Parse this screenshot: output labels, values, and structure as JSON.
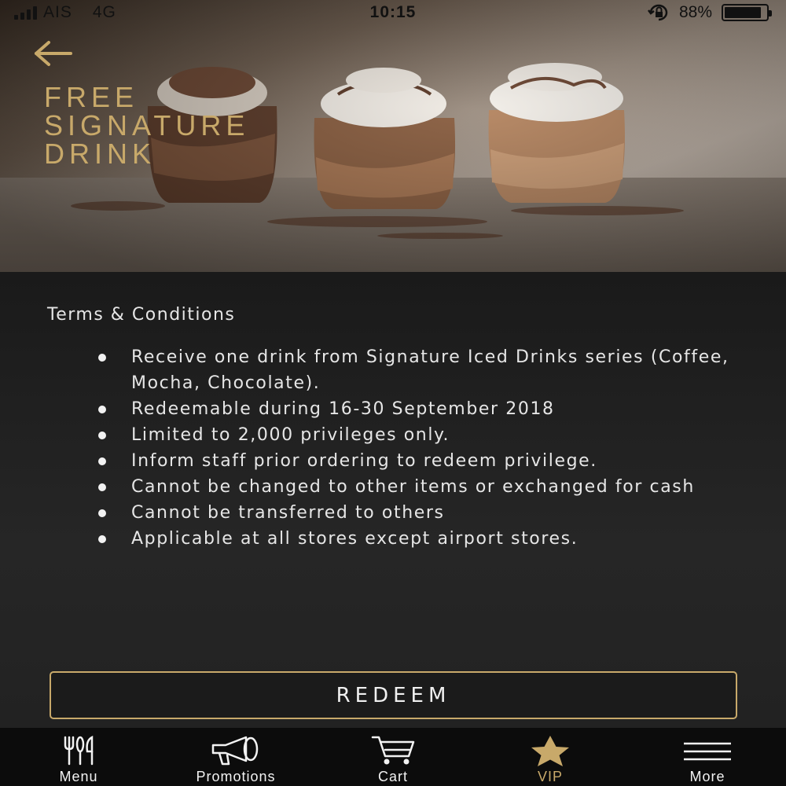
{
  "status_bar": {
    "carrier": "AIS",
    "network": "4G",
    "time": "10:15",
    "battery_percent": "88%",
    "battery_level": 0.88,
    "icons": [
      "signal-icon",
      "rotation-lock-icon",
      "battery-icon"
    ]
  },
  "hero": {
    "title_lines": [
      "FREE",
      "SIGNATURE",
      "DRINK"
    ],
    "back_icon": "arrow-left-icon"
  },
  "terms": {
    "heading": "Terms & Conditions",
    "items": [
      "Receive one drink from Signature Iced Drinks series (Coffee, Mocha, Chocolate).",
      "Redeemable during 16-30 September 2018",
      "Limited to 2,000 privileges only.",
      "Inform staff prior ordering to redeem privilege.",
      "Cannot be changed to other items or exchanged for cash",
      "Cannot be transferred to others",
      "Applicable at all stores except airport stores."
    ]
  },
  "redeem": {
    "label": "REDEEM"
  },
  "tab_bar": {
    "tabs": [
      {
        "label": "Menu",
        "icon": "fork-knife-icon",
        "active": false
      },
      {
        "label": "Promotions",
        "icon": "megaphone-icon",
        "active": false
      },
      {
        "label": "Cart",
        "icon": "cart-icon",
        "active": false
      },
      {
        "label": "VIP",
        "icon": "star-icon",
        "active": true
      },
      {
        "label": "More",
        "icon": "hamburger-icon",
        "active": false
      }
    ]
  },
  "colors": {
    "accent_gold": "#c8a96a",
    "background": "#1c1c1c",
    "tab_bar": "#0c0c0c",
    "text": "#e8e8e8"
  }
}
